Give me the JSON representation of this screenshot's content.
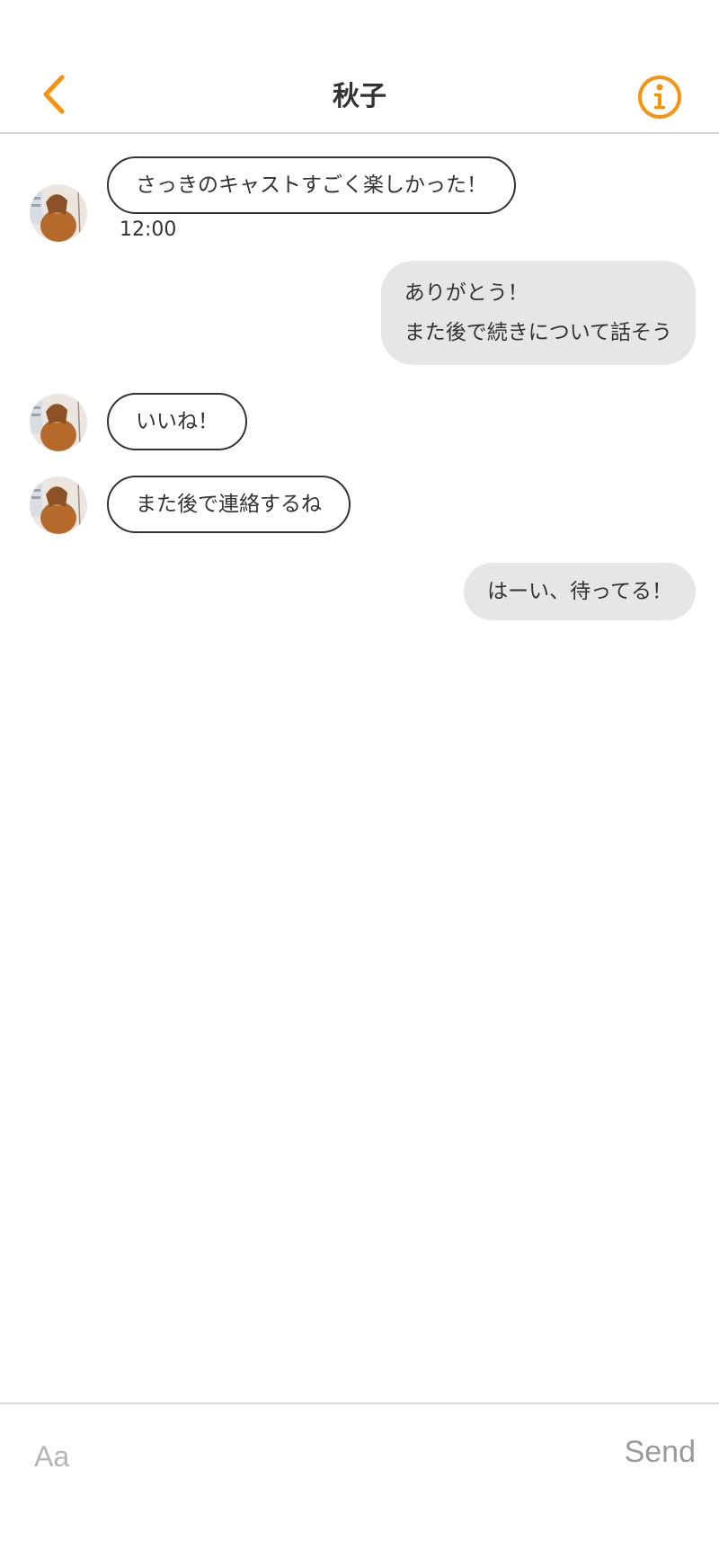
{
  "header": {
    "title": "秋子",
    "back_icon": "chevron-left-icon",
    "info_icon": "info-circle-icon",
    "accent_color": "#F7930E"
  },
  "messages": [
    {
      "sender": "contact",
      "text": "さっきのキャストすごく楽しかった！",
      "time": "12:00"
    },
    {
      "sender": "me",
      "lines": [
        "ありがとう！",
        "また後で続きについて話そう"
      ]
    },
    {
      "sender": "contact",
      "text": "いいね！"
    },
    {
      "sender": "contact",
      "text": "また後で連絡するね"
    },
    {
      "sender": "me",
      "text": "はーい、待ってる！"
    }
  ],
  "composer": {
    "placeholder": "Aa",
    "value": "",
    "send_label": "Send"
  }
}
